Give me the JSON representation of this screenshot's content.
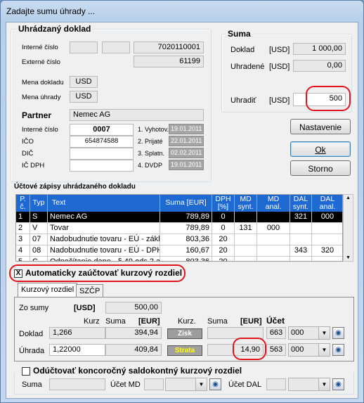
{
  "window": {
    "title": "Zadajte sumu úhrady ..."
  },
  "doklad": {
    "title": "Uhrádzaný doklad",
    "interne_label": "Interné číslo",
    "interne_value": "7020110001",
    "externe_label": "Externé číslo",
    "externe_value": "61199",
    "mena_dokladu_label": "Mena dokladu",
    "mena_dokladu_value": "USD",
    "mena_uhrady_label": "Mena úhrady",
    "mena_uhrady_value": "USD"
  },
  "partner": {
    "title": "Partner",
    "name": "Nemec AG",
    "interne_label": "Interné číslo",
    "interne_value": "0007",
    "ico_label": "IČO",
    "ico_value": "654874588",
    "dic_label": "DIČ",
    "dic_value": "",
    "icdph_label": "IČ DPH",
    "icdph_value": "",
    "dates": [
      {
        "label": "1. Vyhotov.",
        "value": "19.01.2011"
      },
      {
        "label": "2. Prijaté",
        "value": "22.01.2011"
      },
      {
        "label": "3. Splatn.",
        "value": "02.02.2011"
      },
      {
        "label": "4. DVDP",
        "value": "19.01.2011"
      }
    ]
  },
  "suma": {
    "title": "Suma",
    "doklad_label": "Doklad",
    "doklad_cur": "[USD]",
    "doklad_value": "1 000,00",
    "uhradene_label": "Uhradené",
    "uhradene_cur": "[USD]",
    "uhradene_value": "0,00",
    "uhradit_label": "Uhradiť",
    "uhradit_cur": "[USD]",
    "uhradit_value": "500"
  },
  "buttons": {
    "nastavenie": "Nastavenie",
    "ok": "Ok",
    "storno": "Storno"
  },
  "ucty": {
    "title": "Účtové zápisy uhrádzaného dokladu",
    "headers": [
      {
        "l1": "P.",
        "l2": "č."
      },
      {
        "l1": "Typ",
        "l2": ""
      },
      {
        "l1": "Text",
        "l2": ""
      },
      {
        "l1": "Suma [EUR]",
        "l2": ""
      },
      {
        "l1": "DPH",
        "l2": "[%]"
      },
      {
        "l1": "MD",
        "l2": "synt."
      },
      {
        "l1": "MD",
        "l2": "anal."
      },
      {
        "l1": "DAL",
        "l2": "synt."
      },
      {
        "l1": "DAL",
        "l2": "anal."
      }
    ],
    "rows": [
      [
        "1",
        "S",
        "Nemec AG",
        "789,89",
        "0",
        "",
        "",
        "321",
        "000"
      ],
      [
        "2",
        "V",
        "Tovar",
        "789,89",
        "0",
        "131",
        "000",
        "",
        ""
      ],
      [
        "3",
        "07",
        "Nadobudnutie tovaru - EÚ - zákl",
        "803,36",
        "20",
        "",
        "",
        "",
        ""
      ],
      [
        "4",
        "08",
        "Nadobudnutie tovaru - EÚ - DPH",
        "160,67",
        "20",
        "",
        "",
        "343",
        "320"
      ],
      [
        "5",
        "C",
        "Odpočítanie dane - § 49 ods.2 a",
        "803,36",
        "20",
        "",
        "",
        "",
        ""
      ]
    ]
  },
  "auto": {
    "label": "Automaticky zaúčtovať kurzový rozdiel",
    "checked": "X"
  },
  "tabs": [
    "Kurzový rozdiel",
    "SZČP"
  ],
  "kurz": {
    "zo_sumy_label": "Zo sumy",
    "zo_sumy_cur": "[USD]",
    "zo_sumy_value": "500,00",
    "hdr_kurz": "Kurz",
    "hdr_suma": "Suma",
    "hdr_eur": "[EUR]",
    "hdr_kurz2": "Kurz.",
    "hdr_suma2": "Suma",
    "hdr_eur2": "[EUR]",
    "hdr_ucet": "Účet",
    "doklad_label": "Doklad",
    "doklad_kurz": "1,266",
    "doklad_suma": "394,94",
    "doklad_tag": "Zisk",
    "doklad_diff": "",
    "doklad_ucet": "663",
    "doklad_anal": "000",
    "uhrada_label": "Úhrada",
    "uhrada_kurz": "1,22000",
    "uhrada_suma": "409,84",
    "uhrada_tag": "Strata",
    "uhrada_diff": "14,90",
    "uhrada_ucet": "563",
    "uhrada_anal": "000"
  },
  "koncorocny": {
    "label": "Odúčtovať koncoročný saldokontný kurzový rozdiel",
    "suma_label": "Suma",
    "ucet_md_label": "Účet MD",
    "ucet_dal_label": "Účet DAL"
  },
  "colors": {
    "accent_red": "#e0141c",
    "header_blue": "#1e69d2",
    "zisk_bg": "#9c9c9c",
    "strata_bg": "#a0a0a0",
    "strata_text": "#ffff00"
  }
}
